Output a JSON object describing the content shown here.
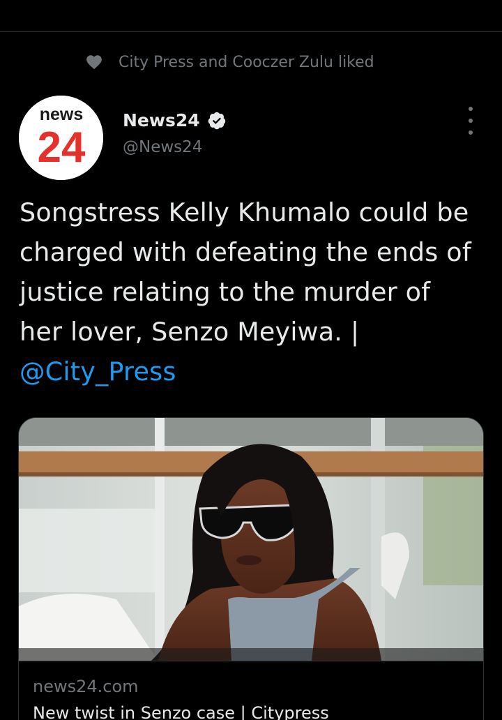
{
  "social_context": {
    "icon": "heart-icon",
    "text": "City Press and Cooczer Zulu liked"
  },
  "author": {
    "avatar": {
      "line1": "news",
      "line2": "24",
      "brand_color": "#e4312b",
      "text_color": "#1a1a1a"
    },
    "name": "News24",
    "verified_icon": "verified-badge-icon",
    "handle": "@News24"
  },
  "more_icon": "more-vertical-icon",
  "tweet": {
    "text": "Songstress Kelly Khumalo could be charged with defeating the ends of justice relating to the murder of her lover, Senzo Meyiwa. | ",
    "mention": "@City_Press"
  },
  "link_card": {
    "domain": "news24.com",
    "title": "New twist in Senzo case | Citypress"
  },
  "colors": {
    "background": "#000000",
    "text_primary": "#e7e9ea",
    "text_secondary": "#71767b",
    "accent_link": "#1d9bf0",
    "divider": "#2f3336"
  }
}
